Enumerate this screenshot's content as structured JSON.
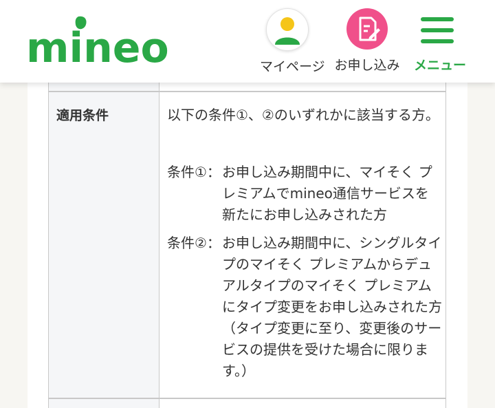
{
  "header": {
    "logo_text": "mineo",
    "mypage_label": "マイページ",
    "apply_label": "お申し込み",
    "menu_label": "メニュー"
  },
  "colors": {
    "brand_green": "#2aa846",
    "apply_pink": "#f0508a",
    "avatar_yellow": "#f5c518"
  },
  "table": {
    "row_header": "適用条件",
    "intro": "以下の条件①、②のいずれかに該当する方。",
    "conditions": [
      {
        "label": "条件①：",
        "text": "お申し込み期間中に、マイそく プレミアムでmineo通信サービスを新たにお申し込みされた方"
      },
      {
        "label": "条件②：",
        "text": "お申し込み期間中に、シングルタイプのマイそく プレミアムからデュアルタイプのマイそく プレミアムにタイプ変更をお申し込みされた方（タイプ変更に至り、変更後のサービスの提供を受けた場合に限ります。）"
      }
    ]
  }
}
